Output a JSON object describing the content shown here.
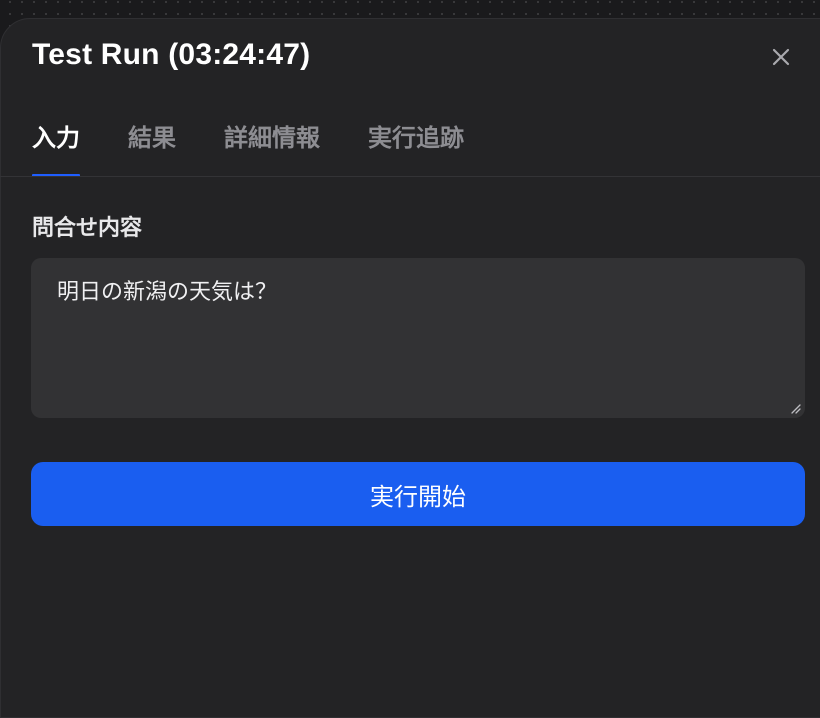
{
  "dialog": {
    "title": "Test Run (03:24:47)",
    "close_icon": "close-icon"
  },
  "tabs": [
    {
      "label": "入力",
      "active": true
    },
    {
      "label": "結果",
      "active": false
    },
    {
      "label": "詳細情報",
      "active": false
    },
    {
      "label": "実行追跡",
      "active": false
    }
  ],
  "form": {
    "query_label": "問合せ内容",
    "query_value": "明日の新潟の天気は？"
  },
  "actions": {
    "run_label": "実行開始"
  },
  "colors": {
    "accent": "#1a5ef0",
    "panel_bg": "#232325",
    "input_bg": "#323234"
  }
}
